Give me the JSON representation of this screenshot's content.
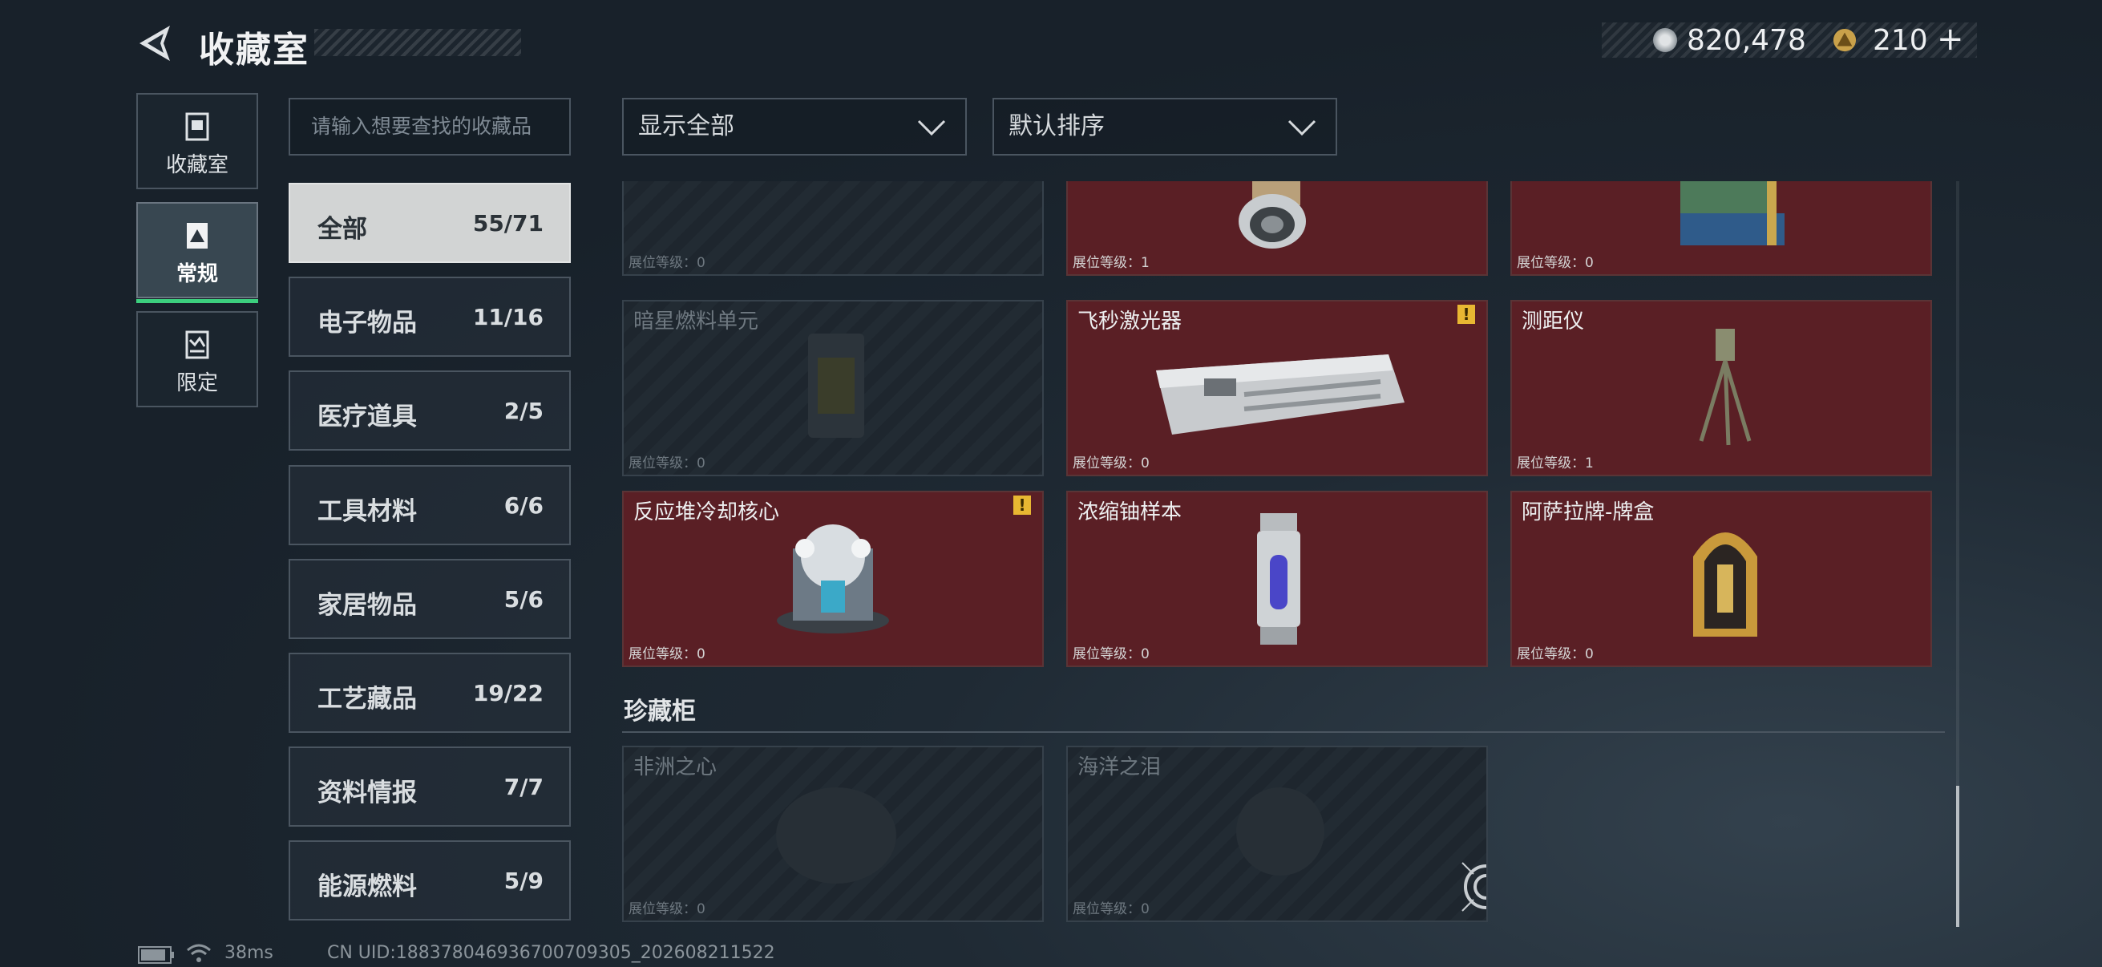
{
  "header": {
    "title": "收藏室",
    "currency_silver": "820,478",
    "currency_gold": "210",
    "currency_gold_plus": "+"
  },
  "nav": [
    {
      "label": "收藏室",
      "icon": "collection-icon"
    },
    {
      "label": "常规",
      "icon": "standard-icon"
    },
    {
      "label": "限定",
      "icon": "limited-icon"
    }
  ],
  "search": {
    "placeholder": "请输入想要查找的收藏品"
  },
  "filters": {
    "show": "显示全部",
    "sort": "默认排序"
  },
  "categories": [
    {
      "name": "全部",
      "count": "55/71"
    },
    {
      "name": "电子物品",
      "count": "11/16"
    },
    {
      "name": "医疗道具",
      "count": "2/5"
    },
    {
      "name": "工具材料",
      "count": "6/6"
    },
    {
      "name": "家居物品",
      "count": "5/6"
    },
    {
      "name": "工艺藏品",
      "count": "19/22"
    },
    {
      "name": "资料情报",
      "count": "7/7"
    },
    {
      "name": "能源燃料",
      "count": "5/9"
    }
  ],
  "items": [
    {
      "name": "",
      "level": "展位等级：0"
    },
    {
      "name": "",
      "level": "展位等级：1"
    },
    {
      "name": "",
      "level": "展位等级：0"
    },
    {
      "name": "暗星燃料单元",
      "level": "展位等级：0"
    },
    {
      "name": "飞秒激光器",
      "level": "展位等级：0",
      "alert": "!"
    },
    {
      "name": "测距仪",
      "level": "展位等级：1"
    },
    {
      "name": "反应堆冷却核心",
      "level": "展位等级：0",
      "alert": "!"
    },
    {
      "name": "浓缩铀样本",
      "level": "展位等级：0"
    },
    {
      "name": "阿萨拉牌-牌盒",
      "level": "展位等级：0"
    }
  ],
  "treasure": {
    "title": "珍藏柜",
    "items": [
      {
        "name": "非洲之心",
        "level": "展位等级：0"
      },
      {
        "name": "海洋之泪",
        "level": "展位等级：0"
      }
    ]
  },
  "status": {
    "ping": "38ms",
    "uid": "CN UID:188378046936700709305_202608211522"
  },
  "colors": {
    "accent": "#3ccf7e",
    "card_owned": "#5a1f25",
    "alert": "#e8b732"
  }
}
